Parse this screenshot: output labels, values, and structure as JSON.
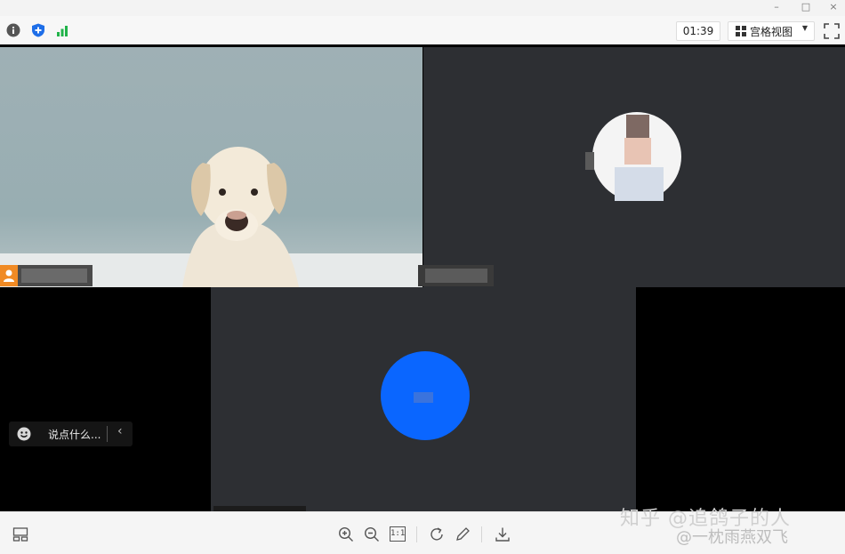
{
  "window": {
    "minimize_glyph": "–",
    "maximize_glyph": "□",
    "close_glyph": "×"
  },
  "toolbar": {
    "info_icon": "info-icon",
    "security_icon": "shield-plus-icon",
    "signal_icon": "signal-bars-icon",
    "timer": "01:39",
    "view_label": "宫格视图",
    "fullscreen_icon": "fullscreen-icon"
  },
  "participants": [
    {
      "tile": "camera-dog",
      "name_hidden": true
    },
    {
      "tile": "avatar-person",
      "name_hidden": true
    },
    {
      "tile": "avatar-blue",
      "name_hidden": true
    }
  ],
  "chat": {
    "placeholder": "说点什么..."
  },
  "bottom": {
    "icons": [
      "layout-icon",
      "zoom-in-icon",
      "zoom-out-icon",
      "actual-size-icon",
      "rotate-icon",
      "edit-icon",
      "download-icon"
    ],
    "actual_size_label": "1:1"
  },
  "watermark": {
    "line1": "知乎 @追鸽子的人",
    "line2": "@一枕雨燕双飞"
  },
  "colors": {
    "accent_orange": "#f08a24",
    "blue_avatar": "#0a66ff",
    "signal_green": "#21b34a",
    "security_blue": "#1e6ee8"
  }
}
